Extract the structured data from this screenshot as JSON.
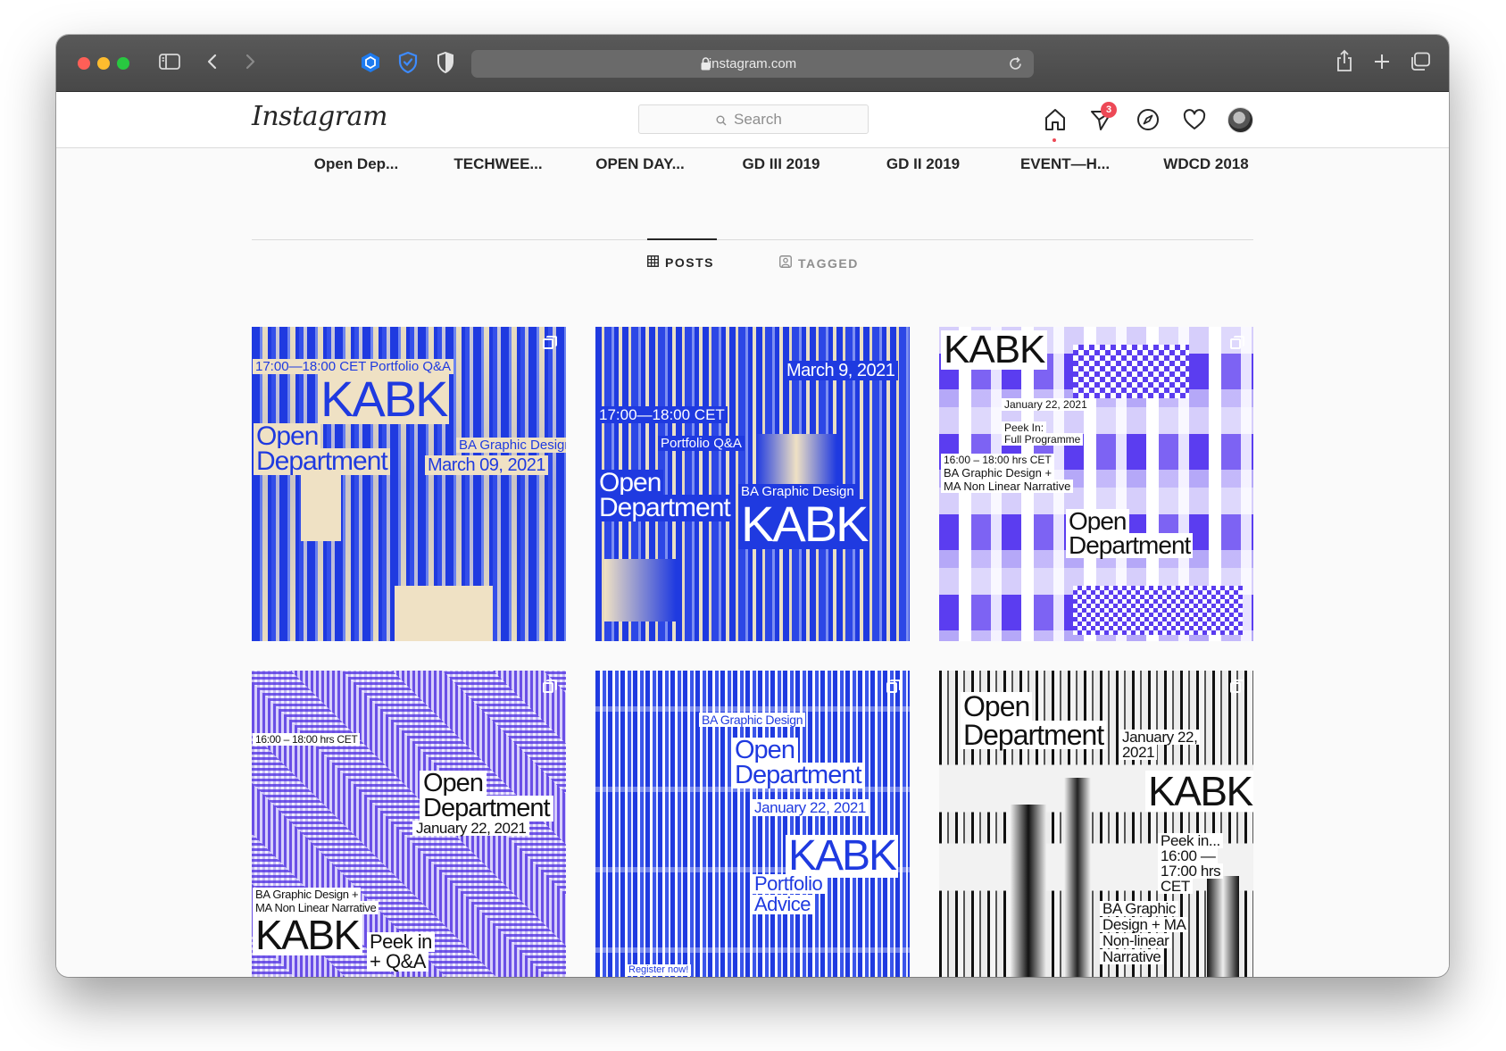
{
  "browser": {
    "url": "instagram.com"
  },
  "instagram": {
    "logo": "Instagram",
    "search_placeholder": "Search",
    "notification_count": "3"
  },
  "highlights": [
    "Open Dep...",
    "TECHWEE...",
    "OPEN DAY...",
    "GD III 2019",
    "GD II 2019",
    "EVENT—H...",
    "WDCD 2018"
  ],
  "tabs": {
    "posts": "POSTS",
    "tagged": "TAGGED"
  },
  "posts": [
    {
      "lines": [
        "17:00—18:00 CET Portfolio Q&A",
        "KABK",
        "Open",
        "Department",
        "BA Graphic Design",
        "March 09, 2021"
      ]
    },
    {
      "lines": [
        "March 9, 2021",
        "17:00—18:00 CET",
        "Portfolio Q&A",
        "Open",
        "Department",
        "BA Graphic Design",
        "KABK"
      ]
    },
    {
      "lines": [
        "KABK",
        "January 22, 2021",
        "Peek In:",
        "Full Programme",
        "16:00 – 18:00 hrs CET",
        "BA Graphic Design +",
        "MA Non Linear Narrative",
        "Open",
        "Department"
      ]
    },
    {
      "lines": [
        "16:00 – 18:00 hrs CET",
        "Open",
        "Department",
        "January 22, 2021",
        "BA Graphic Design +",
        "MA Non Linear Narrative",
        "KABK",
        "Peek in",
        "+ Q&A"
      ]
    },
    {
      "lines": [
        "BA Graphic Design",
        "Open",
        "Department",
        "January 22, 2021",
        "KABK",
        "Portfolio",
        "Advice",
        "Register now!"
      ]
    },
    {
      "lines": [
        "Open",
        "Department",
        "January 22,",
        "2021",
        "KABK",
        "Peek in...",
        "16:00 —",
        "17:00 hrs",
        "CET",
        "BA Graphic",
        "Design + MA",
        "Non-linear",
        "Narrative"
      ]
    }
  ],
  "colors": {
    "kabk_blue": "#1f3ae0",
    "cream": "#efe1c4",
    "violet": "#6a4fe6",
    "badge_red": "#ed4956"
  }
}
